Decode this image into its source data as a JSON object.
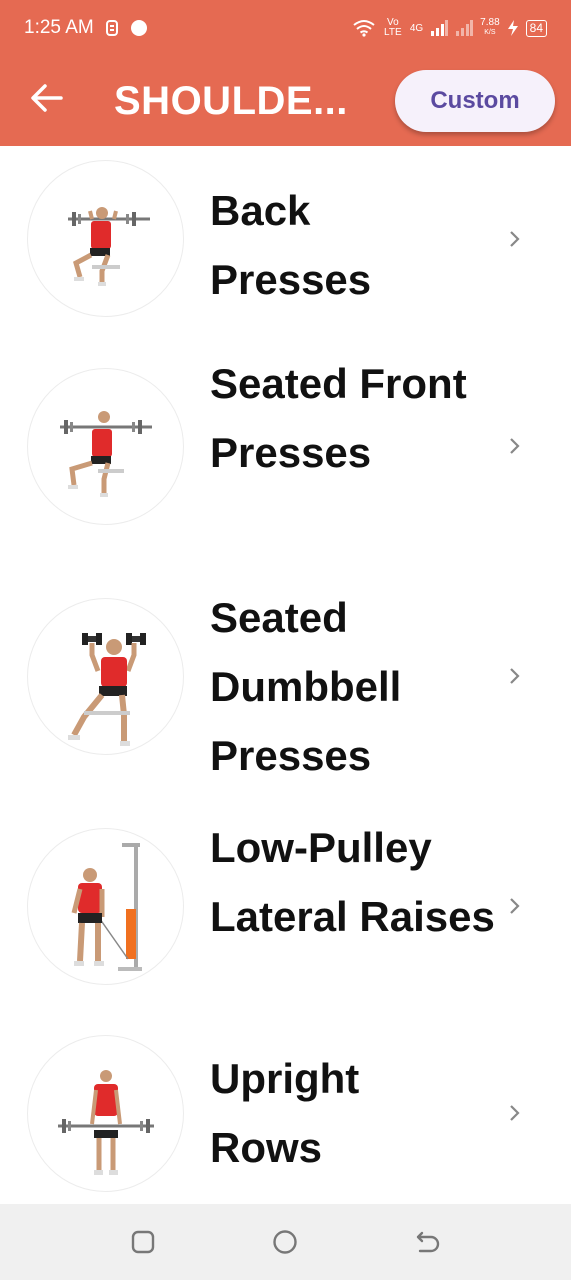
{
  "status_bar": {
    "time": "1:25 AM",
    "net_speed_value": "7.88",
    "net_speed_unit": "K/S",
    "network_4g": "4G",
    "volte": "Vo LTE",
    "battery": "84"
  },
  "app_bar": {
    "title": "SHOULDE...",
    "custom_label": "Custom"
  },
  "exercises": [
    {
      "name": "Back Presses"
    },
    {
      "name": "Seated Front Presses"
    },
    {
      "name": "Seated Dumbbell Presses"
    },
    {
      "name": "Low-Pulley Lateral Raises"
    },
    {
      "name": "Upright Rows"
    }
  ],
  "colors": {
    "app_bar": "#e56a52",
    "custom_button_bg": "#f6f1fb",
    "custom_button_text": "#5b4aa0",
    "nav_bar": "#f0f0f0"
  },
  "icons": {
    "back": "arrow-left-icon",
    "chevron": "chevron-right-icon",
    "nav_recent": "square-icon",
    "nav_home": "circle-icon",
    "nav_back": "return-icon"
  }
}
